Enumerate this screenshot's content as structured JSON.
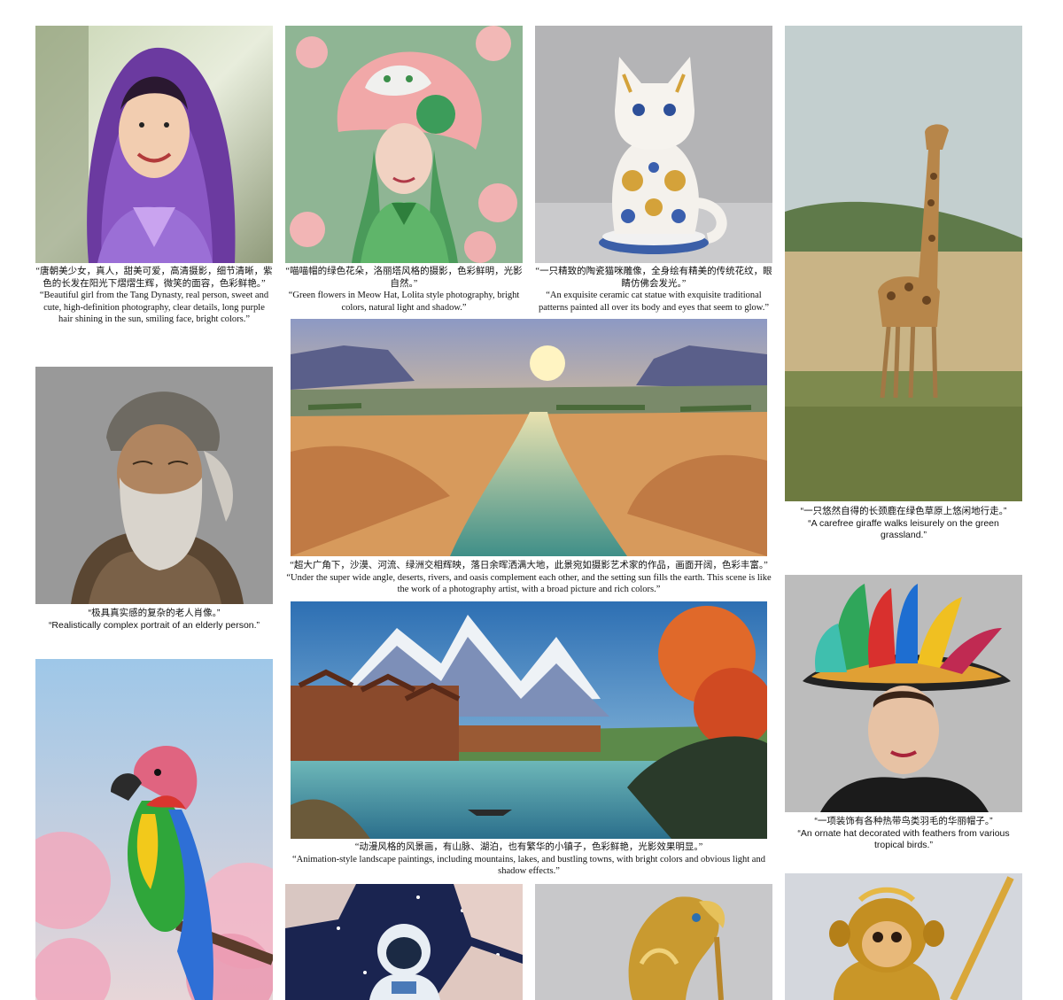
{
  "figures": [
    {
      "id": "girl-purple",
      "icon": "portrait-girl-image",
      "caption_zh": "“唐朝美少女，真人，甜美可爱，高清摄影，细节清晰，紫色的长发在阳光下熠熠生辉，微笑的面容，色彩鲜艳。”",
      "caption_en": "“Beautiful girl from the Tang Dynasty, real person, sweet and cute, high-definition photography, clear details, long purple hair shining in the sun, smiling face, bright colors.”"
    },
    {
      "id": "meow-hat",
      "icon": "meow-hat-image",
      "caption_zh": "“喵喵帽的绿色花朵，洛丽塔风格的摄影，色彩鲜明，光影自然。”",
      "caption_en": "“Green flowers in Meow Hat, Lolita style photography, bright colors, natural light and shadow.”"
    },
    {
      "id": "ceramic-cat",
      "icon": "ceramic-cat-image",
      "caption_zh": "“一只精致的陶瓷猫咪雕像，全身绘有精美的传统花纹，眼睛仿佛会发光。”",
      "caption_en": "“An exquisite ceramic cat statue with exquisite traditional patterns painted all over its body and eyes that seem to glow.”"
    },
    {
      "id": "giraffe",
      "icon": "giraffe-image",
      "caption_zh": "“一只悠然自得的长颈鹿在绿色草原上悠闲地行走。”",
      "caption_en": "“A carefree giraffe walks leisurely on the green grassland.”"
    },
    {
      "id": "old-man",
      "icon": "elderly-portrait-image",
      "caption_zh": "“极具真实感的复杂的老人肖像。”",
      "caption_en": "“Realistically complex portrait of an elderly person.”"
    },
    {
      "id": "desert-river",
      "icon": "desert-river-image",
      "caption_zh": "“超大广角下，沙漠、河流、绿洲交相辉映，落日余晖洒满大地，此景宛如摄影艺术家的作品，画面开阔，色彩丰富。”",
      "caption_en": "“Under the super wide angle, deserts, rivers, and oasis complement each other, and the setting sun fills the earth. This scene is like the work of a photography artist, with a broad picture and rich colors.”"
    },
    {
      "id": "anime-landscape",
      "icon": "anime-landscape-image",
      "caption_zh": "“动漫风格的风景画，有山脉、湖泊，也有繁华的小镇子，色彩鲜艳，光影效果明显。”",
      "caption_en": "“Animation-style landscape paintings, including mountains, lakes, and bustling towns, with bright colors and obvious light and shadow effects.”"
    },
    {
      "id": "feather-hat",
      "icon": "feather-hat-image",
      "caption_zh": "“一项装饰有各种热带鸟类羽毛的华丽帽子。”",
      "caption_en": "“An ornate hat decorated with feathers from various tropical birds.”"
    },
    {
      "id": "parrot",
      "icon": "parrot-image"
    },
    {
      "id": "astronaut",
      "icon": "astronaut-image"
    },
    {
      "id": "golden-parrot",
      "icon": "golden-parrot-image"
    },
    {
      "id": "golden-monkey",
      "icon": "golden-monkey-image"
    }
  ]
}
